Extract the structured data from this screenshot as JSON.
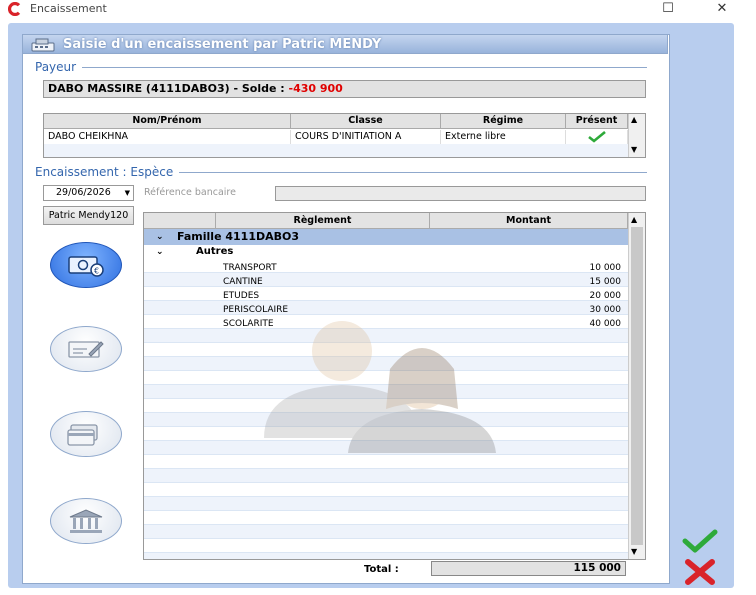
{
  "window": {
    "title": "Encaissement",
    "maximize_glyph": "☐",
    "close_glyph": "✕"
  },
  "panel": {
    "title": "Saisie d'un encaissement par Patric MENDY"
  },
  "payer": {
    "section_title": "Payeur",
    "text": "DABO MASSIRE (4111DABO3) - Solde :",
    "balance": "-430 900"
  },
  "students": {
    "columns": [
      "Nom/Prénom",
      "Classe",
      "Régime",
      "Présent"
    ],
    "rows": [
      {
        "name": "DABO CHEIKHNA",
        "classe": "COURS D'INITIATION A",
        "regime": "Externe libre",
        "present": true
      }
    ]
  },
  "encaissement": {
    "section_title": "Encaissement : Espèce",
    "date": "29/06/2026",
    "reference_label": "Référence bancaire",
    "reference_value": "",
    "user_button": "Patric Mendy120"
  },
  "payment_modes": [
    {
      "name": "cash-icon",
      "active": true
    },
    {
      "name": "cheque-icon",
      "active": false
    },
    {
      "name": "card-icon",
      "active": false
    },
    {
      "name": "bank-icon",
      "active": false
    }
  ],
  "reglements": {
    "columns": [
      "Règlement",
      "Montant"
    ],
    "group": "Famille 4111DABO3",
    "subgroup": "Autres",
    "lines": [
      {
        "label": "TRANSPORT",
        "amount": "10 000"
      },
      {
        "label": "CANTINE",
        "amount": "15 000"
      },
      {
        "label": "ETUDES",
        "amount": "20 000"
      },
      {
        "label": "PERISCOLAIRE",
        "amount": "30 000"
      },
      {
        "label": "SCOLARITE",
        "amount": "40 000"
      }
    ]
  },
  "total": {
    "label": "Total :",
    "value": "115 000"
  },
  "colors": {
    "accent": "#3466ad",
    "header": "#98b3db",
    "negative": "#e00000",
    "ok": "#2eaa3a",
    "cancel": "#d9232a"
  }
}
